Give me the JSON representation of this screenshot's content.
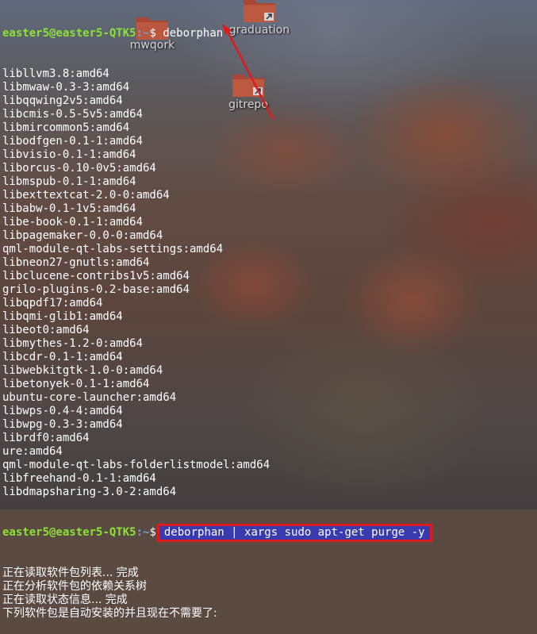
{
  "desktop": {
    "icons": [
      {
        "label": "graduation"
      },
      {
        "label": "gitrepo"
      },
      {
        "label": "mwqork"
      }
    ]
  },
  "terminal": {
    "prompt_user_host": "easter5@easter5-QTK5",
    "prompt_path": ":~",
    "prompt_symbol": "$",
    "first_command": "deborphan",
    "packages": [
      "libllvm3.8:amd64",
      "libmwaw-0.3-3:amd64",
      "libqqwing2v5:amd64",
      "libcmis-0.5-5v5:amd64",
      "libmircommon5:amd64",
      "libodfgen-0.1-1:amd64",
      "libvisio-0.1-1:amd64",
      "liborcus-0.10-0v5:amd64",
      "libmspub-0.1-1:amd64",
      "libexttextcat-2.0-0:amd64",
      "libabw-0.1-1v5:amd64",
      "libe-book-0.1-1:amd64",
      "libpagemaker-0.0-0:amd64",
      "qml-module-qt-labs-settings:amd64",
      "libneon27-gnutls:amd64",
      "libclucene-contribs1v5:amd64",
      "grilo-plugins-0.2-base:amd64",
      "libqpdf17:amd64",
      "libqmi-glib1:amd64",
      "libeot0:amd64",
      "libmythes-1.2-0:amd64",
      "libcdr-0.1-1:amd64",
      "libwebkitgtk-1.0-0:amd64",
      "libetonyek-0.1-1:amd64",
      "ubuntu-core-launcher:amd64",
      "libwps-0.4-4:amd64",
      "libwpg-0.3-3:amd64",
      "librdf0:amd64",
      "ure:amd64",
      "qml-module-qt-labs-folderlistmodel:amd64",
      "libfreehand-0.1-1:amd64",
      "libdmapsharing-3.0-2:amd64"
    ],
    "second_prompt_user_host": "easter5@easter5-QTK5",
    "second_prompt_path": ":~",
    "second_prompt_symbol": "$",
    "second_command": "deborphan | xargs sudo apt-get purge -y",
    "output_lines": [
      "正在读取软件包列表... 完成",
      "正在分析软件包的依赖关系树",
      "正在读取状态信息... 完成",
      "下列软件包是自动安装的并且现在不需要了:"
    ]
  },
  "colors": {
    "highlight_border": "#e01a1a",
    "arrow": "#e01a1a",
    "selection_bg": "#3a3ab0",
    "prompt_user": "#8ae234",
    "prompt_path": "#729fcf"
  }
}
